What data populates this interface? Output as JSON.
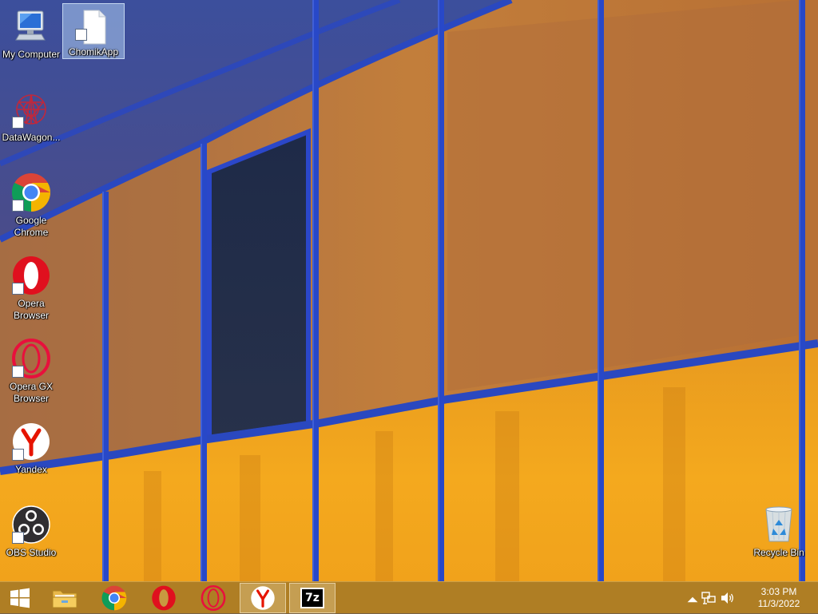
{
  "desktop": {
    "icons": [
      {
        "label": "My Computer",
        "icon": "computer-icon"
      },
      {
        "label": "ChomikApp",
        "icon": "blank-file-icon"
      },
      {
        "label": "DataWagon...",
        "icon": "datawagon-icon"
      },
      {
        "label": "Google Chrome",
        "icon": "chrome-icon"
      },
      {
        "label": "Opera Browser",
        "icon": "opera-icon"
      },
      {
        "label": "Opera GX Browser",
        "icon": "opera-gx-icon"
      },
      {
        "label": "Yandex",
        "icon": "yandex-icon"
      },
      {
        "label": "OBS Studio",
        "icon": "obs-icon"
      },
      {
        "label": "Recycle Bin",
        "icon": "recycle-bin-icon"
      }
    ],
    "selected_icon": "ChomikApp"
  },
  "taskbar": {
    "items": [
      {
        "name": "start",
        "icon": "windows-logo-icon"
      },
      {
        "name": "file-explorer",
        "icon": "folder-icon"
      },
      {
        "name": "chrome",
        "icon": "chrome-icon"
      },
      {
        "name": "opera",
        "icon": "opera-icon"
      },
      {
        "name": "opera-gx",
        "icon": "opera-gx-icon"
      },
      {
        "name": "yandex",
        "icon": "yandex-icon",
        "active": true
      },
      {
        "name": "7zip",
        "icon": "7zip-icon",
        "text": "7z"
      }
    ],
    "tray": {
      "icons": [
        "show-hidden-icons-chevron",
        "network-icon",
        "volume-icon"
      ],
      "time": "3:03 PM",
      "date": "11/3/2022"
    }
  },
  "colors": {
    "accent_orange": "#f0a020",
    "frame_blue": "#2a48c0",
    "chrome_red": "#db4437",
    "opera_red": "#e0101e",
    "yandex_red": "#e61400"
  }
}
